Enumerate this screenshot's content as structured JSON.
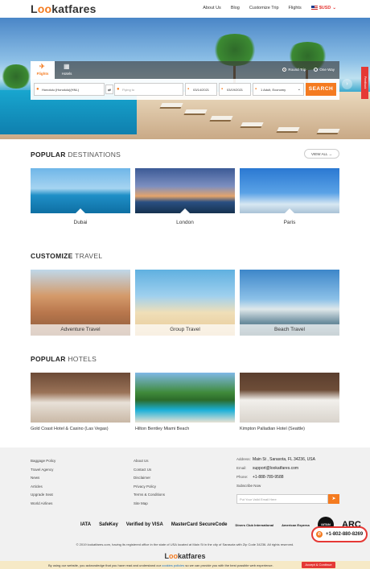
{
  "header": {
    "logo_prefix": "L",
    "logo_o": "oo",
    "logo_suffix": "katfares",
    "nav": [
      "About Us",
      "Blog",
      "Customize Trip",
      "Flights"
    ],
    "currency": "$USD"
  },
  "search": {
    "tabs": [
      {
        "label": "Flights",
        "icon": "plane-icon"
      },
      {
        "label": "Hotels",
        "icon": "building-icon"
      }
    ],
    "trip_types": [
      "Round Trip",
      "One Way"
    ],
    "from": "Honolulu (Honolulu)(HNL)",
    "to_placeholder": "Flying to",
    "depart": "03/14/2021",
    "return": "03/19/2021",
    "travellers": "1 Adult, Economy",
    "button": "SEARCH",
    "feedback": "Feedback"
  },
  "destinations": {
    "title_bold": "POPULAR",
    "title_light": "DESTINATIONS",
    "view_all": "VIEW ALL",
    "items": [
      "Dubai",
      "London",
      "Paris"
    ]
  },
  "customize": {
    "title_bold": "CUSTOMIZE",
    "title_light": "TRAVEL",
    "items": [
      "Adventure Travel",
      "Group Travel",
      "Beach Travel"
    ]
  },
  "hotels": {
    "title_bold": "POPULAR",
    "title_light": "HOTELS",
    "items": [
      "Gold Coast Hotel & Casino (Las Vegas)",
      "Hilton Bentley Miami Beach",
      "Kimpton Palladian Hotel (Seattle)"
    ]
  },
  "footer": {
    "col1": [
      "Baggage Policy",
      "Travel Agency",
      "News",
      "Articles",
      "Upgrade Seat",
      "World Airlines"
    ],
    "col2": [
      "About Us",
      "Contact Us",
      "Disclaimer",
      "Privacy Policy",
      "Terms & Conditions",
      "Site Map"
    ],
    "address_label": "Address:",
    "address": "Main St , Sarasota, FL 34236, USA",
    "email_label": "Email:",
    "email": "support@lookatfares.com",
    "phone_label": "Phone:",
    "phone": "+1-888-789-9588",
    "subscribe": "Subscribe Now",
    "subscribe_placeholder": "Put Your Valid Email Here",
    "logos": [
      "IATA",
      "SafeKey",
      "Verified by VISA",
      "MasterCard SecureCode",
      "Diners Club International",
      "American Express",
      "IATAN",
      "ARC"
    ],
    "copyright": "© 2019 lookatfares.com, having its registered office in the state of USA located at Main St in the city of Sarasota with Zip Code 34236. All rights reserved.",
    "support_phone": "+1-802-880-8269"
  },
  "cookie": {
    "text": "By using our website, you acknowledge that you have read and understand our",
    "link": "cookies policies",
    "text2": "so we can provide you with the best possible web experience.",
    "button": "Accept & Continue"
  }
}
